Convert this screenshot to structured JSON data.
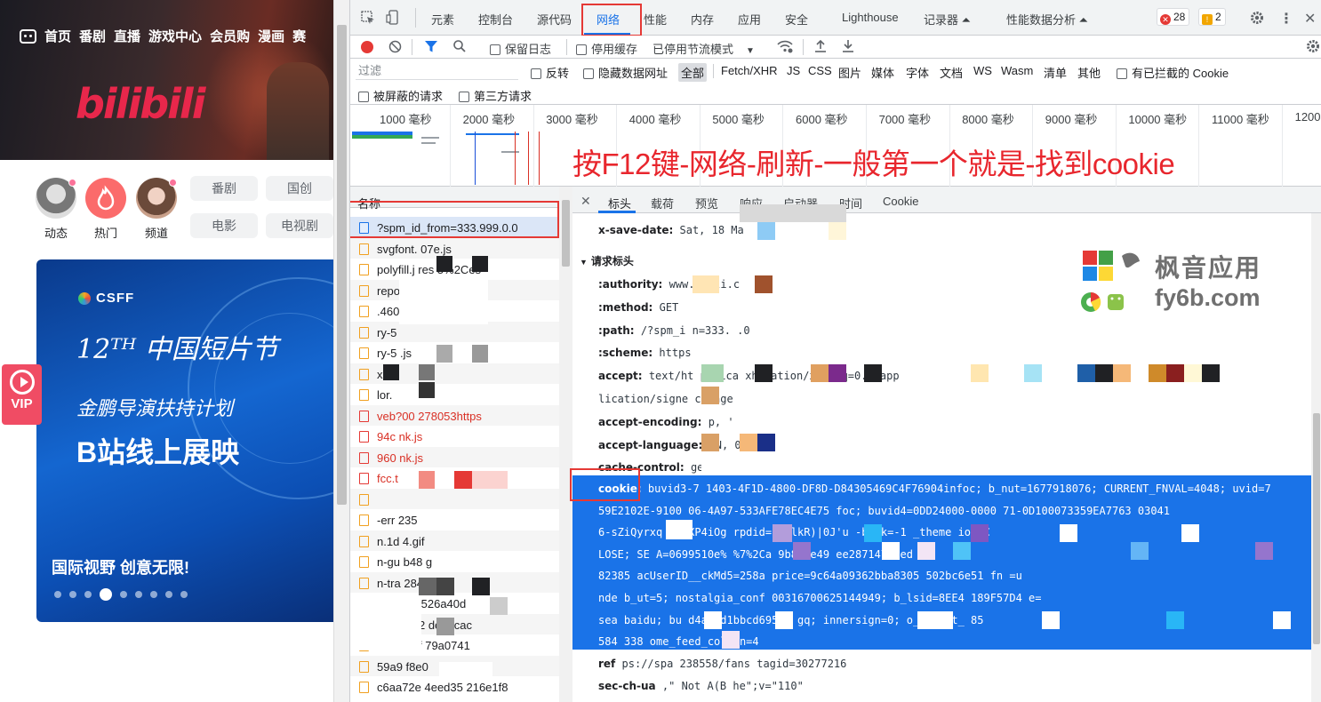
{
  "site": {
    "nav": [
      "首页",
      "番剧",
      "直播",
      "游戏中心",
      "会员购",
      "漫画",
      "赛"
    ],
    "logo_text": "bilibili",
    "channels": [
      {
        "label": "动态",
        "color": "#8c8c8c"
      },
      {
        "label": "热门",
        "color": "#fb6b6b"
      },
      {
        "label": "频道",
        "color": "#c98a72"
      }
    ],
    "categories": [
      "番剧",
      "国创",
      "电影",
      "电视剧"
    ],
    "promo": {
      "brand": "CSFF",
      "title": "12ᵀᴴ 中国短片节",
      "subtitle": "金鹏导演扶持计划",
      "headline": "B站线上展映",
      "tagline": "国际视野 创意无限!",
      "dots": 9,
      "active_dot": 3
    },
    "vip_label": "VIP"
  },
  "devtools": {
    "tabs": [
      "元素",
      "控制台",
      "源代码",
      "网络",
      "性能",
      "内存",
      "应用",
      "安全",
      "Lighthouse",
      "记录器 ⏶",
      "性能数据分析 ⏶"
    ],
    "active_tab": "网络",
    "error_count": "28",
    "warning_count": "2",
    "toolbar": {
      "preserve_log": "保留日志",
      "disable_cache": "停用缓存",
      "throttle": "已停用节流模式"
    },
    "filter": {
      "placeholder": "过滤",
      "invert": "反转",
      "hide_data_urls": "隐藏数据网址",
      "types": [
        "全部",
        "Fetch/XHR",
        "JS",
        "CSS",
        "图片",
        "媒体",
        "字体",
        "文档",
        "WS",
        "Wasm",
        "清单",
        "其他"
      ],
      "blocked_cookies": "有已拦截的 Cookie",
      "blocked_requests": "被屏蔽的请求",
      "third_party": "第三方请求"
    },
    "overview_ticks": [
      "1000 毫秒",
      "2000 毫秒",
      "3000 毫秒",
      "4000 毫秒",
      "5000 毫秒",
      "6000 毫秒",
      "7000 毫秒",
      "8000 毫秒",
      "9000 毫秒",
      "10000 毫秒",
      "11000 毫秒",
      "12000"
    ],
    "annotation": "按F12键-网络-刷新-一般第一个就是-找到cookie",
    "request_list": {
      "header": "名称",
      "items": [
        {
          "name": "?spm_id_from=333.999.0.0",
          "kind": "doc"
        },
        {
          "name": "svgfont.      07e.js",
          "kind": "js"
        },
        {
          "name": "polyfill.j      res      5%2Ces",
          "kind": "js"
        },
        {
          "name": "     repo",
          "kind": "js"
        },
        {
          "name": "   .460",
          "kind": "js"
        },
        {
          "name": "     ry-5",
          "kind": "js"
        },
        {
          "name": "     ry-5             .js",
          "kind": "js"
        },
        {
          "name": "    x.9c",
          "kind": "js"
        },
        {
          "name": "    lor.",
          "kind": "js"
        },
        {
          "name": "veb?00              278053https",
          "kind": "err"
        },
        {
          "name": "    94c             nk.js",
          "kind": "err"
        },
        {
          "name": "    960             nk.js",
          "kind": "err"
        },
        {
          "name": "     fcc.t",
          "kind": "err"
        },
        {
          "name": "",
          "kind": "js"
        },
        {
          "name": "    -err          235",
          "kind": "js"
        },
        {
          "name": "    n.1d         4.gif",
          "kind": "img"
        },
        {
          "name": "    n-gu         b48       g",
          "kind": "img"
        },
        {
          "name": "    n-tra         284      g",
          "kind": "img"
        },
        {
          "name": "     734      c2ff      526a40d",
          "kind": "img"
        },
        {
          "name": "     8574      fbf2      dea4cac",
          "kind": "img"
        },
        {
          "name": "     5244      69f       79a0741",
          "kind": "img"
        },
        {
          "name": "     59a9                  f8e0",
          "kind": "img"
        },
        {
          "name": "c6aa72e      4eed35      216e1f8",
          "kind": "img"
        }
      ]
    },
    "details": {
      "tabs": [
        "标头",
        "载荷",
        "预览",
        "响应",
        "启动器",
        "时间",
        "Cookie"
      ],
      "active_tab": "标头",
      "response_header_partial": {
        "name": "x-save-date:",
        "value": "Sat, 18 Ma"
      },
      "section_title": "请求标头",
      "headers": [
        {
          "name": ":authority:",
          "value": "www.        bili.c"
        },
        {
          "name": ":method:",
          "value": "GET"
        },
        {
          "name": ":path:",
          "value": "/?spm_i     n=333.      .0"
        },
        {
          "name": ":scheme:",
          "value": "https"
        },
        {
          "name": "accept:",
          "value": "text/ht      pplica       xht                 ation/xml                                       ;q=0.8,app"
        },
        {
          "name": "",
          "value": "lication/signe      change"
        },
        {
          "name": "accept-encoding:",
          "value": "   p, '"
        },
        {
          "name": "accept-language:",
          "value": "   CN,      0.9"
        },
        {
          "name": "cache-control:",
          "value": "   ge=0"
        }
      ],
      "cookie_name": "cookie:",
      "cookie_lines": [
        "buvid3-7       1403-4F1D-4800-DF8D-D84305469C4F76904infoc; b_nut=1677918076; CURRENT_FNVAL=4048;     uvid=7",
        "59E2102E-9100      06-4A97-533AFE78EC4E75      foc; buvid4=0DD24000-0000        71-0D100073359EA7763      03041",
        "6-sZiQyrxq      bUlXP4iOg          rpdid=|(       lkR)|0J'u                -back=-1       _theme      ion=C",
        "LOSE; SE      A=0699510e%       %7%2Ca                           9b804e49       ee287147        Ded        30",
        "82385      acUserID__ckMd5=258a              price=9c64a09362bba8305        502bc6e51      fn       =u",
        "nde      b_ut=5; nostalgia_conf          00316700625144949; b_lsid=8EE4      189F57D4          e=",
        "sea       baidu; bu               d4a44d1bbcd6953c                gq; innersign=0;      o_offset_      85",
        "584       338                 ome_feed_column=4"
      ],
      "after_headers": [
        {
          "name": "ref",
          "value": "   ps://spa                  238558/fans        tagid=30277216"
        },
        {
          "name": "sec-ch-ua",
          "value": "                    ,\" Not A(B                    he\";v=\"110\""
        }
      ]
    },
    "watermark": {
      "brand": "枫音应用",
      "url": "fy6b.com"
    }
  }
}
